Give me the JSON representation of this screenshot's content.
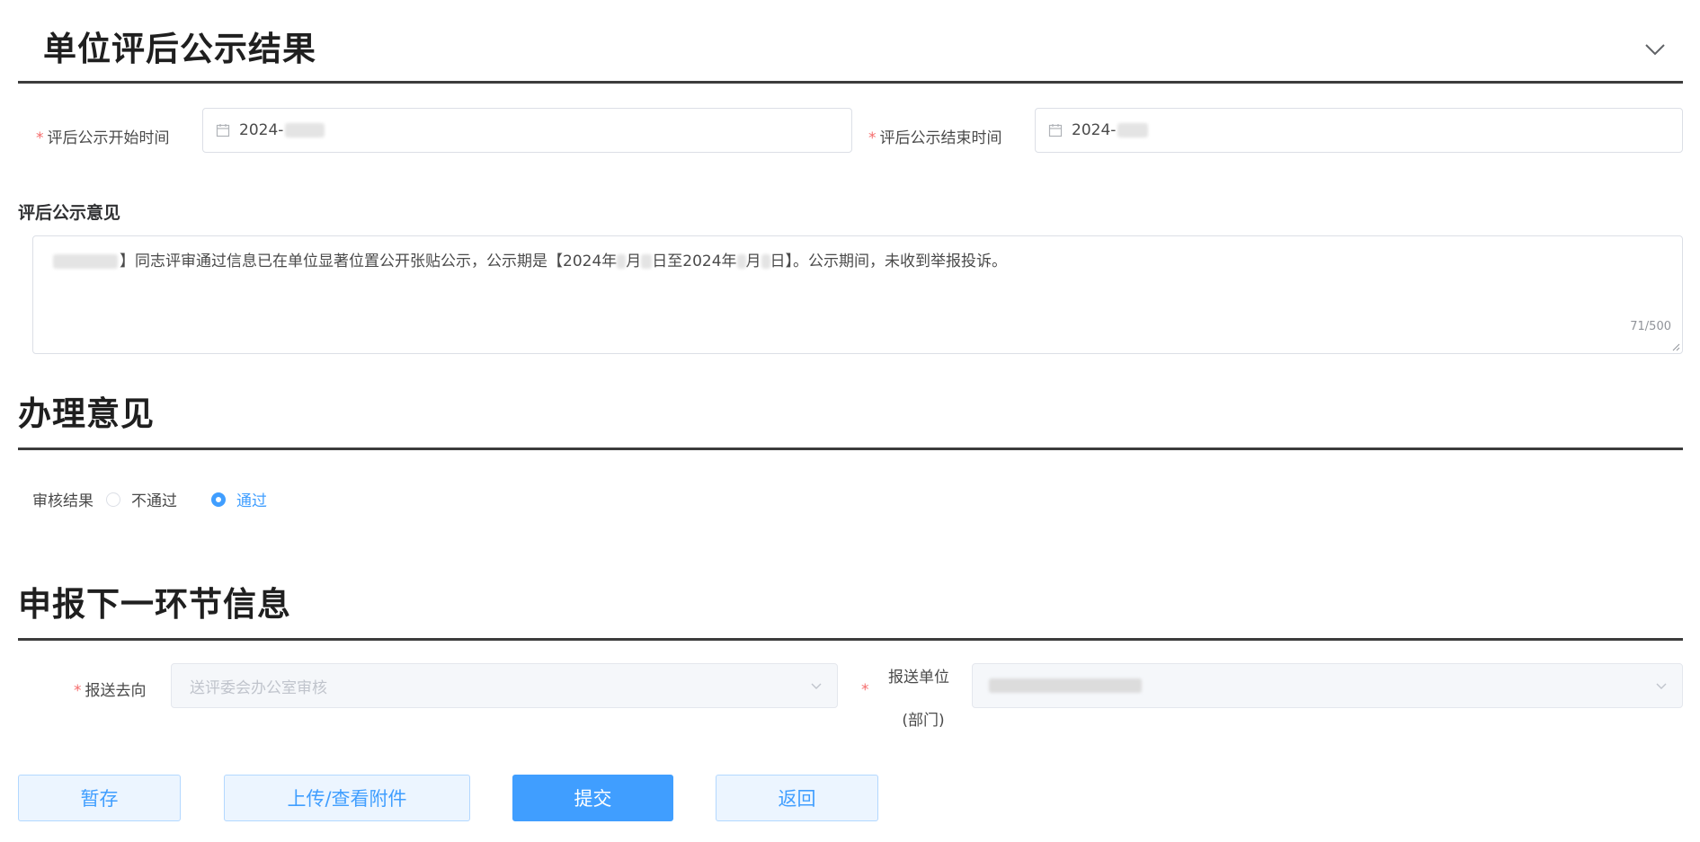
{
  "section1": {
    "title": "单位评后公示结果",
    "start_label": "评后公示开始时间",
    "start_value": "2024-",
    "end_label": "评后公示结束时间",
    "end_value": "2024-",
    "opinion_label": "评后公示意见",
    "opinion_text_a": "】同志评审通过信息已在单位显著位置公开张贴公示，公示期是【2024年",
    "opinion_text_b": "月",
    "opinion_text_c": "日至2024年",
    "opinion_text_d": "月",
    "opinion_text_e": "日】。公示期间，未收到举报投诉。",
    "opinion_counter": "71/500"
  },
  "section2": {
    "title": "办理意见",
    "review_label": "审核结果",
    "options": [
      "不通过",
      "通过"
    ],
    "selected": "通过"
  },
  "section3": {
    "title": "申报下一环节信息",
    "send_to_label": "报送去向",
    "send_to_placeholder": "送评委会办公室审核",
    "send_unit_label_line1": "报送单位",
    "send_unit_label_line2": "(部门)"
  },
  "buttons": {
    "save": "暂存",
    "attach": "上传/查看附件",
    "submit": "提交",
    "back": "返回"
  },
  "colors": {
    "accent": "#409eff",
    "required": "#f56c6c",
    "light_button_bg": "#ecf5ff"
  },
  "icons": {
    "collapse": "chevron-down-icon",
    "date": "calendar-icon",
    "select": "chevron-down-icon"
  }
}
